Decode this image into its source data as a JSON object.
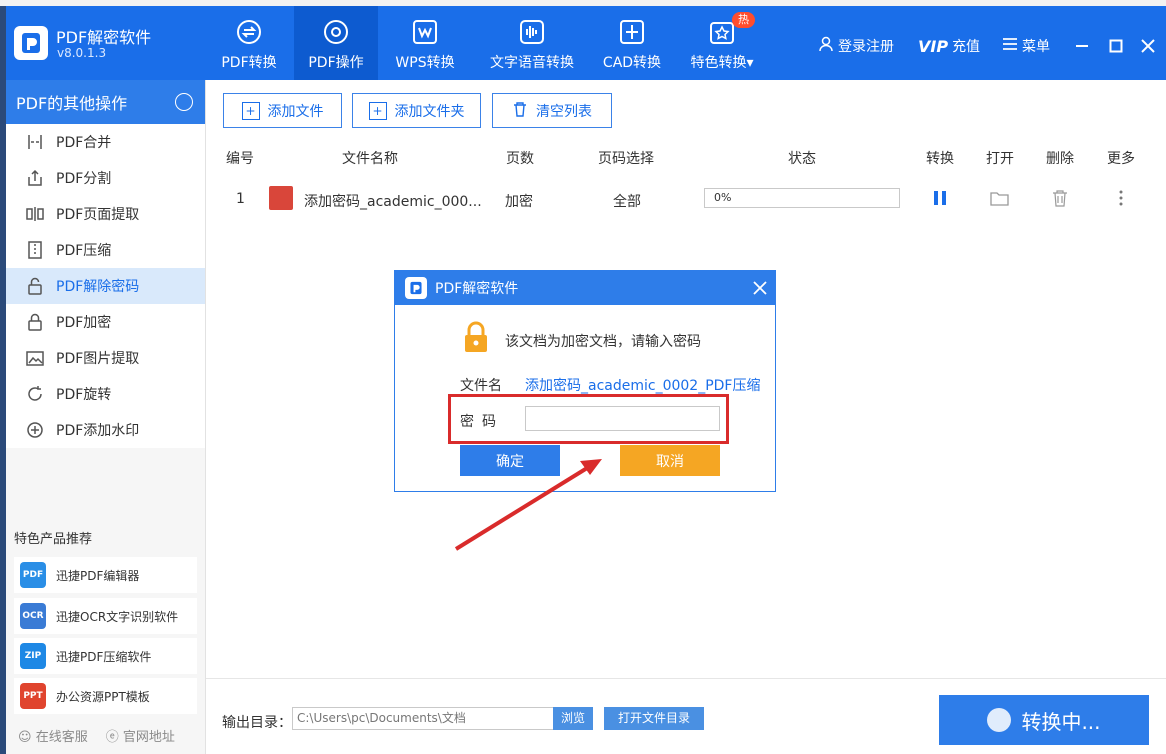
{
  "app": {
    "name": "PDF解密软件",
    "version": "v8.0.1.3"
  },
  "nav": [
    {
      "label": "PDF转换",
      "icon": "convert-icon"
    },
    {
      "label": "PDF操作",
      "icon": "settings-icon"
    },
    {
      "label": "WPS转换",
      "icon": "wps-icon"
    },
    {
      "label": "文字语音转换",
      "icon": "voice-icon"
    },
    {
      "label": "CAD转换",
      "icon": "cad-icon"
    },
    {
      "label": "特色转换▾",
      "icon": "star-icon"
    }
  ],
  "hot_badge": "热",
  "header_right": {
    "login": "登录注册",
    "vip": "VIP",
    "recharge": "充值",
    "menu": "菜单"
  },
  "sidebar": {
    "title": "PDF的其他操作",
    "items": [
      {
        "label": "PDF合并"
      },
      {
        "label": "PDF分割"
      },
      {
        "label": "PDF页面提取"
      },
      {
        "label": "PDF压缩"
      },
      {
        "label": "PDF解除密码"
      },
      {
        "label": "PDF加密"
      },
      {
        "label": "PDF图片提取"
      },
      {
        "label": "PDF旋转"
      },
      {
        "label": "PDF添加水印"
      }
    ],
    "promo_title": "特色产品推荐",
    "promos": [
      {
        "label": "迅捷PDF编辑器",
        "icon_text": "PDF",
        "color": "#2a8ee6"
      },
      {
        "label": "迅捷OCR文字识别软件",
        "icon_text": "OCR",
        "color": "#3a7bd5"
      },
      {
        "label": "迅捷PDF压缩软件",
        "icon_text": "ZIP",
        "color": "#1e88e5"
      },
      {
        "label": "办公资源PPT模板",
        "icon_text": "PPT",
        "color": "#e0442e"
      }
    ],
    "footer": {
      "service": "在线客服",
      "website": "官网地址"
    }
  },
  "toolbar": {
    "add_file": "添加文件",
    "add_folder": "添加文件夹",
    "clear_list": "清空列表"
  },
  "table": {
    "headers": {
      "no": "编号",
      "name": "文件名称",
      "pages": "页数",
      "page_select": "页码选择",
      "status": "状态",
      "convert": "转换",
      "open": "打开",
      "delete": "删除",
      "more": "更多"
    },
    "rows": [
      {
        "no": "1",
        "name": "添加密码_academic_000...",
        "pages": "加密",
        "page_select": "全部",
        "progress": "0%",
        "progress_value": 0
      }
    ]
  },
  "output": {
    "label": "输出目录：",
    "path": "C:\\Users\\pc\\Documents\\文档",
    "browse": "浏览",
    "open_dir": "打开文件目录"
  },
  "convert_button": "转换中...",
  "dialog": {
    "title": "PDF解密软件",
    "message": "该文档为加密文档，请输入密码",
    "file_label": "文件名",
    "file_name": "添加密码_academic_0002_PDF压缩",
    "password_label": "密码",
    "password_value": "",
    "ok": "确定",
    "cancel": "取消"
  },
  "colors": {
    "primary": "#1a6ee9",
    "cancel": "#f5a623",
    "highlight": "#d92b2b"
  }
}
